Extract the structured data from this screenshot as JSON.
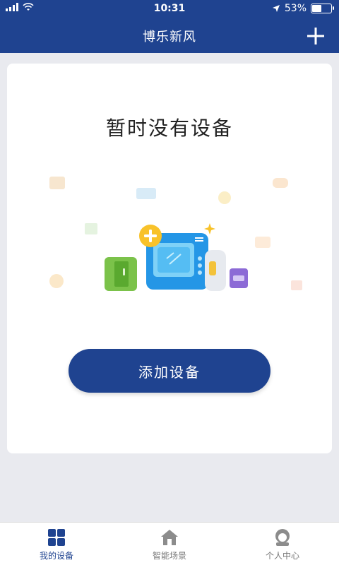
{
  "status": {
    "time": "10:31",
    "battery": "53%",
    "battery_level": 0.53
  },
  "header": {
    "title": "博乐新风",
    "add_icon": "plus-icon"
  },
  "main": {
    "empty_title": "暂时没有设备",
    "add_button_label": "添加设备"
  },
  "tabs": [
    {
      "label": "我的设备",
      "icon": "grid-icon",
      "active": true
    },
    {
      "label": "智能场景",
      "icon": "home-icon",
      "active": false
    },
    {
      "label": "个人中心",
      "icon": "user-icon",
      "active": false
    }
  ],
  "colors": {
    "primary": "#1f4390",
    "inactive": "#8c8c8c"
  }
}
